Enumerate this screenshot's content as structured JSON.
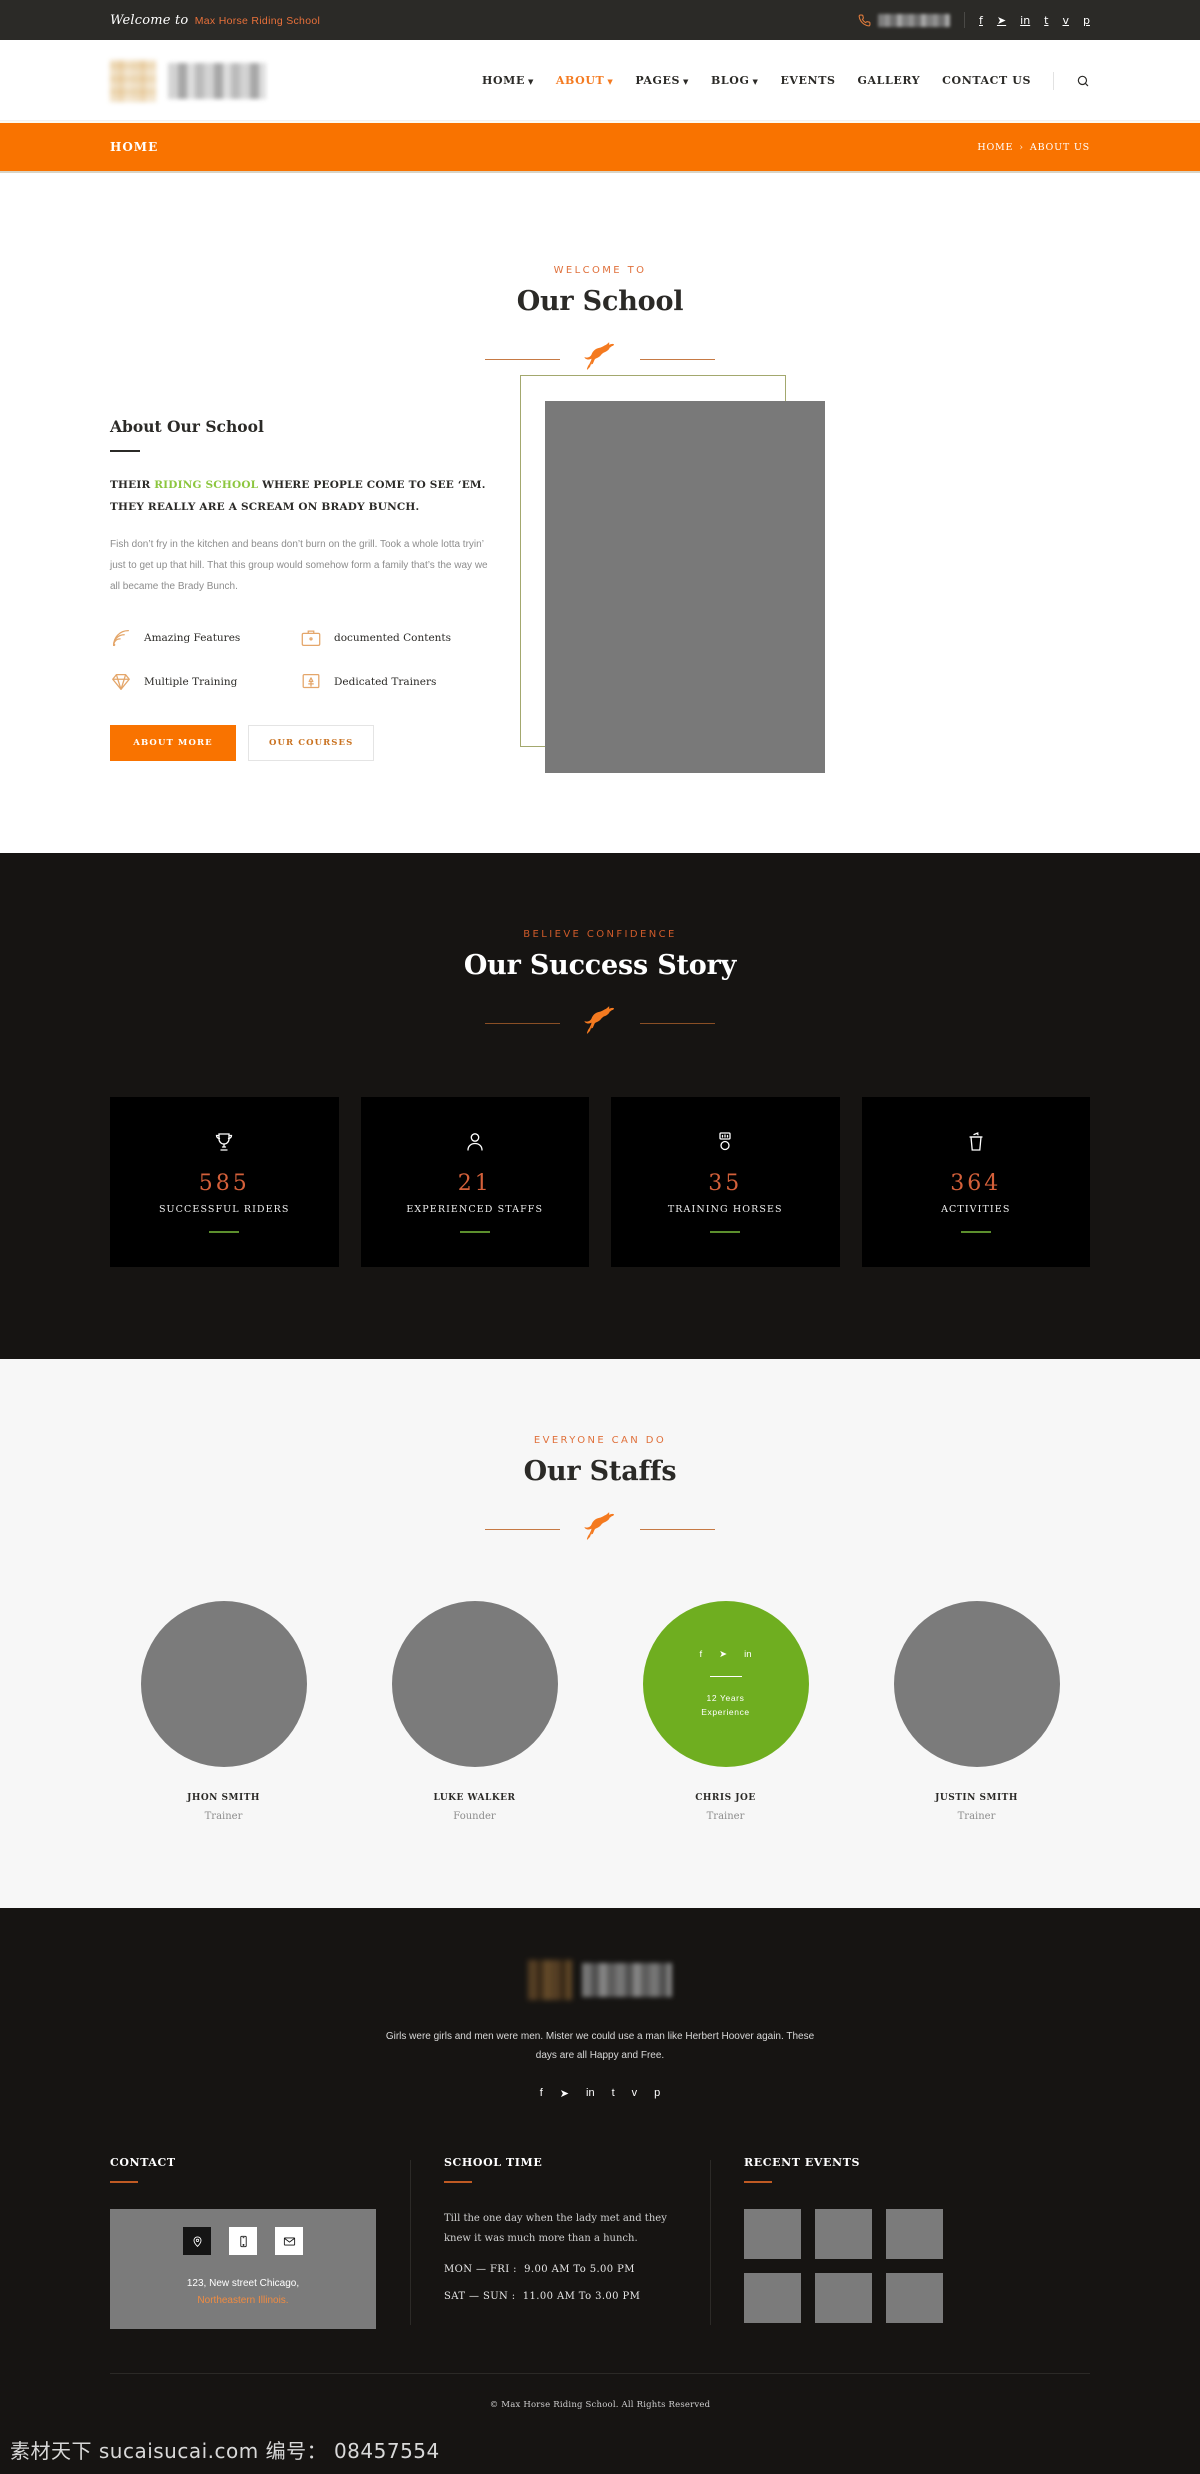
{
  "topbar": {
    "welcome_script": "Welcome to",
    "welcome_brand": "Max Horse Riding School",
    "phone_icon": "phone-icon",
    "phone_value": "",
    "socials": [
      {
        "name": "facebook",
        "glyph": "f"
      },
      {
        "name": "twitter",
        "glyph": "➤"
      },
      {
        "name": "linkedin",
        "glyph": "in"
      },
      {
        "name": "tumblr",
        "glyph": "t"
      },
      {
        "name": "vimeo",
        "glyph": "v"
      },
      {
        "name": "pinterest",
        "glyph": "p"
      }
    ]
  },
  "header": {
    "logo_alt": "Max Horse Riding School",
    "nav": [
      {
        "label": "HOME",
        "caret": true,
        "active": false
      },
      {
        "label": "ABOUT",
        "caret": true,
        "active": true
      },
      {
        "label": "PAGES",
        "caret": true,
        "active": false
      },
      {
        "label": "BLOG",
        "caret": true,
        "active": false
      },
      {
        "label": "EVENTS",
        "caret": false,
        "active": false
      },
      {
        "label": "GALLERY",
        "caret": false,
        "active": false
      },
      {
        "label": "CONTACT US",
        "caret": false,
        "active": false
      }
    ],
    "search_label": "Search"
  },
  "banner": {
    "title": "HOME",
    "crumb_home": "HOME",
    "crumb_sep": "›",
    "crumb_current": "ABOUT US"
  },
  "about": {
    "eyebrow": "WELCOME TO",
    "title": "Our School",
    "heading": "About Our School",
    "lead_1": "THEIR ",
    "lead_hl": "RIDING SCHOOL",
    "lead_2": " WHERE PEOPLE COME TO SEE ‘EM. THEY REALLY ARE A SCREAM ON BRADY BUNCH.",
    "paragraph": "Fish don’t fry in the kitchen and beans don’t burn on the grill. Took a whole lotta tryin’ just to get up that hill. That this group would somehow form a family that’s the way we all became the Brady Bunch.",
    "features": [
      {
        "label": "Amazing Features",
        "icon": "wifi-signal-icon"
      },
      {
        "label": "documented Contents",
        "icon": "briefcase-icon"
      },
      {
        "label": "Multiple Training",
        "icon": "diamond-icon"
      },
      {
        "label": "Dedicated Trainers",
        "icon": "certificate-icon"
      }
    ],
    "btn_primary": "ABOUT MORE",
    "btn_ghost": "OUR COURSES",
    "frame_color": "#a3a86e"
  },
  "success": {
    "eyebrow": "BELIEVE CONFIDENCE",
    "title": "Our Success Story",
    "counters": [
      {
        "icon": "trophy-icon",
        "number": "585",
        "label": "SUCCESSFUL RIDERS"
      },
      {
        "icon": "user-icon",
        "number": "21",
        "label": "EXPERIENCED STAFFS"
      },
      {
        "icon": "medal-icon",
        "number": "35",
        "label": "TRAINING HORSES"
      },
      {
        "icon": "trash-bin-icon",
        "number": "364",
        "label": "ACTIVITIES"
      }
    ]
  },
  "staff": {
    "eyebrow": "EVERYONE CAN DO",
    "title": "Our Staffs",
    "members": [
      {
        "name": "JHON SMITH",
        "role": "Trainer",
        "hovered": false
      },
      {
        "name": "LUKE WALKER",
        "role": "Founder",
        "hovered": false
      },
      {
        "name": "CHRIS JOE",
        "role": "Trainer",
        "hovered": true,
        "years_line1": "12 Years",
        "years_line2": "Experience",
        "socials": [
          {
            "name": "facebook",
            "glyph": "f"
          },
          {
            "name": "twitter",
            "glyph": "➤"
          },
          {
            "name": "linkedin",
            "glyph": "in"
          }
        ]
      },
      {
        "name": "JUSTIN SMITH",
        "role": "Trainer",
        "hovered": false
      }
    ]
  },
  "footer": {
    "tagline": "Girls were girls and men were men. Mister we could use a man like Herbert Hoover again. These days are all Happy and Free.",
    "socials": [
      {
        "name": "facebook",
        "glyph": "f"
      },
      {
        "name": "twitter",
        "glyph": "➤"
      },
      {
        "name": "linkedin",
        "glyph": "in"
      },
      {
        "name": "tumblr",
        "glyph": "t"
      },
      {
        "name": "vimeo",
        "glyph": "v"
      },
      {
        "name": "pinterest",
        "glyph": "p"
      }
    ],
    "contact": {
      "heading": "CONTACT",
      "tabs": [
        {
          "name": "location-pin-icon",
          "active": true
        },
        {
          "name": "mobile-phone-icon",
          "active": false
        },
        {
          "name": "envelope-icon",
          "active": false
        }
      ],
      "address_line1": "123, New street Chicago,",
      "address_line2": "Northeastern Illinois."
    },
    "school_time": {
      "heading": "SCHOOL TIME",
      "paragraph": "Till the one day when the lady met and they knew it was much more than a hunch.",
      "rows": [
        {
          "days": "MON  —  FRI",
          "hours": "9.00  AM  To  5.00 PM"
        },
        {
          "days": "SAT  —  SUN",
          "hours": "11.00  AM  To  3.00 PM"
        }
      ]
    },
    "recent_events": {
      "heading": "RECENT EVENTS",
      "thumbs": 6
    },
    "copyright": "© Max Horse Riding School. All Rights Reserved"
  },
  "watermark": "素材天下 sucaisucai.com  编号： 08457554",
  "colors": {
    "orange": "#f97300",
    "accent_orange": "#e0713c",
    "green": "#8cc63e",
    "staff_green": "#6fae20",
    "dark": "#161412",
    "counter_num": "#d4603a"
  }
}
